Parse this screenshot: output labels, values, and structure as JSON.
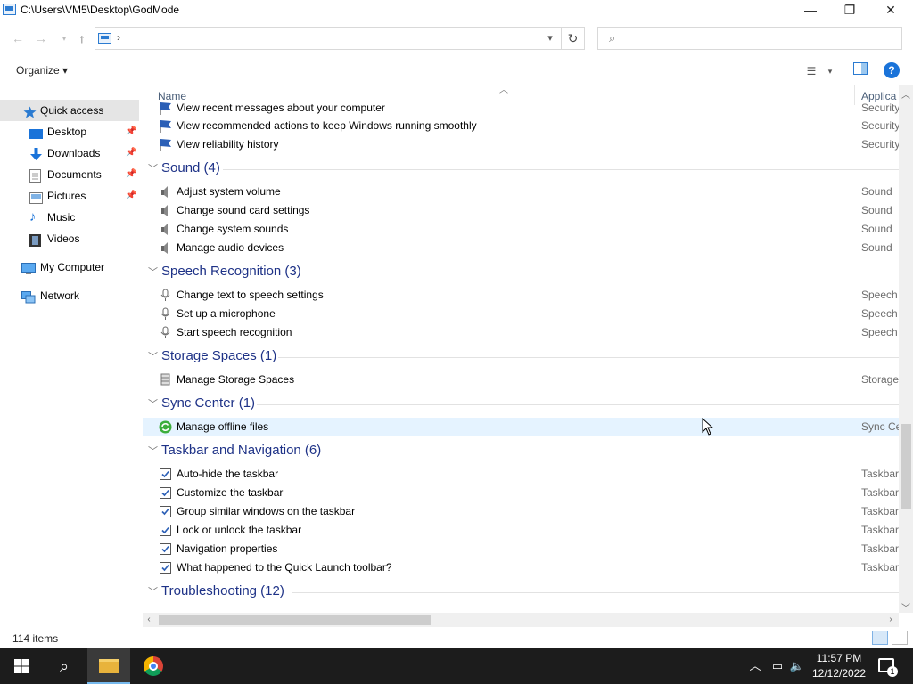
{
  "window": {
    "title": "C:\\Users\\VM5\\Desktop\\GodMode",
    "minimize_glyph": "—",
    "maximize_glyph": "❐",
    "close_glyph": "✕"
  },
  "address": {
    "separator": "›",
    "search_placeholder": ""
  },
  "toolbar": {
    "organize_label": "Organize ▾",
    "help_label": "?"
  },
  "sidebar": {
    "items": [
      {
        "label": "Quick access",
        "icon": "star-icon"
      },
      {
        "label": "Desktop",
        "icon": "desktop-icon",
        "pinned": true
      },
      {
        "label": "Downloads",
        "icon": "download-icon",
        "pinned": true
      },
      {
        "label": "Documents",
        "icon": "documents-icon",
        "pinned": true
      },
      {
        "label": "Pictures",
        "icon": "pictures-icon",
        "pinned": true
      },
      {
        "label": "Music",
        "icon": "music-icon"
      },
      {
        "label": "Videos",
        "icon": "videos-icon"
      },
      {
        "label": "My Computer",
        "icon": "computer-icon"
      },
      {
        "label": "Network",
        "icon": "network-icon"
      }
    ]
  },
  "columns": {
    "name": "Name",
    "application": "Applica"
  },
  "rows_top": [
    {
      "text": "View recent messages about your computer",
      "cat": "Security"
    },
    {
      "text": "View recommended actions to keep Windows running smoothly",
      "cat": "Security"
    },
    {
      "text": "View reliability history",
      "cat": "Security"
    }
  ],
  "groups": {
    "sound": {
      "title": "Sound (4)",
      "items": [
        {
          "text": "Adjust system volume",
          "cat": "Sound"
        },
        {
          "text": "Change sound card settings",
          "cat": "Sound"
        },
        {
          "text": "Change system sounds",
          "cat": "Sound"
        },
        {
          "text": "Manage audio devices",
          "cat": "Sound"
        }
      ]
    },
    "speech": {
      "title": "Speech Recognition (3)",
      "items": [
        {
          "text": "Change text to speech settings",
          "cat": "Speech"
        },
        {
          "text": "Set up a microphone",
          "cat": "Speech"
        },
        {
          "text": "Start speech recognition",
          "cat": "Speech"
        }
      ]
    },
    "storage": {
      "title": "Storage Spaces (1)",
      "items": [
        {
          "text": "Manage Storage Spaces",
          "cat": "Storage"
        }
      ]
    },
    "sync": {
      "title": "Sync Center (1)",
      "items": [
        {
          "text": "Manage offline files",
          "cat": "Sync Ce"
        }
      ]
    },
    "taskbar": {
      "title": "Taskbar and Navigation (6)",
      "items": [
        {
          "text": "Auto-hide the taskbar",
          "cat": "Taskbar"
        },
        {
          "text": "Customize the taskbar",
          "cat": "Taskbar"
        },
        {
          "text": "Group similar windows on the taskbar",
          "cat": "Taskbar"
        },
        {
          "text": "Lock or unlock the taskbar",
          "cat": "Taskbar"
        },
        {
          "text": "Navigation properties",
          "cat": "Taskbar"
        },
        {
          "text": "What happened to the Quick Launch toolbar?",
          "cat": "Taskbar"
        }
      ]
    },
    "troubleshooting": {
      "title": "Troubleshooting (12)"
    }
  },
  "status": {
    "item_count": "114 items"
  },
  "taskbar_clock": {
    "time": "11:57 PM",
    "date": "12/12/2022"
  },
  "colors": {
    "group_title": "#1e3287",
    "hover_row": "#e5f3ff",
    "selected_nav": "#e5e5e5",
    "taskbar_bg": "#1c1c1c"
  }
}
